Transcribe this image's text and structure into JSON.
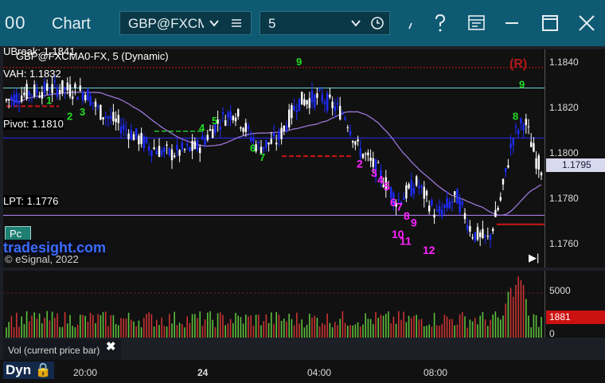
{
  "window": {
    "logo": "00",
    "title": "Chart",
    "symbol": "GBP@FXCM",
    "interval": "5"
  },
  "colors": {
    "titlebar": "#0e5a73",
    "up_candle": "#ffffff",
    "down_candle": "#1d2cff",
    "vah_line": "#6fd4d4",
    "pivot_line": "#2a2aff",
    "lpt_line": "#b28cff",
    "avg_line": "#9b77d6",
    "red_level": "#d01414",
    "green_level": "#22c22a",
    "count_magenta": "#ff22ff",
    "count_green": "#22dd22",
    "vol_up": "#5cbf3c",
    "vol_down": "#c83232"
  },
  "chart": {
    "study_label": "GBP@FXCMA0-FX, 5 (Dynamic)",
    "ubreak_label": "UBreak: 1.1841",
    "vah_label": "VAH: 1.1832",
    "pivot_label": "Pivot: 1.1810",
    "lpt_label": "LPT: 1.1776",
    "r_marker": "(R)",
    "pc_button": "Pc",
    "tradesight": "tradesight.com",
    "copyright": "© eSignal, 2022",
    "current_price": "1.1795",
    "volume_label": "Vol (current price bar)",
    "volume_close": "✖",
    "volume_current": "1881",
    "dyn_label": "Dyn"
  },
  "chart_data": {
    "type": "candlestick",
    "ylim": [
      1.1753,
      1.1849
    ],
    "price_ticks": [
      "1.1840",
      "1.1820",
      "1.1800",
      "1.1780",
      "1.1760"
    ],
    "volume_ticks": [
      "5000",
      "0"
    ],
    "time_labels": [
      "20:00",
      "24",
      "04:00",
      "08:00"
    ],
    "levels": [
      {
        "name": "UBreak",
        "value": 1.1841
      },
      {
        "name": "VAH",
        "value": 1.1832
      },
      {
        "name": "Pivot",
        "value": 1.181
      },
      {
        "name": "LPT",
        "value": 1.1776
      }
    ],
    "magenta_counts": [
      "2",
      "3",
      "4",
      "5",
      "6",
      "7",
      "8",
      "9",
      "10",
      "11",
      "12"
    ],
    "green_counts": [
      "9",
      "1",
      "2",
      "3",
      "4",
      "5",
      "6",
      "7",
      "8",
      "9"
    ]
  }
}
